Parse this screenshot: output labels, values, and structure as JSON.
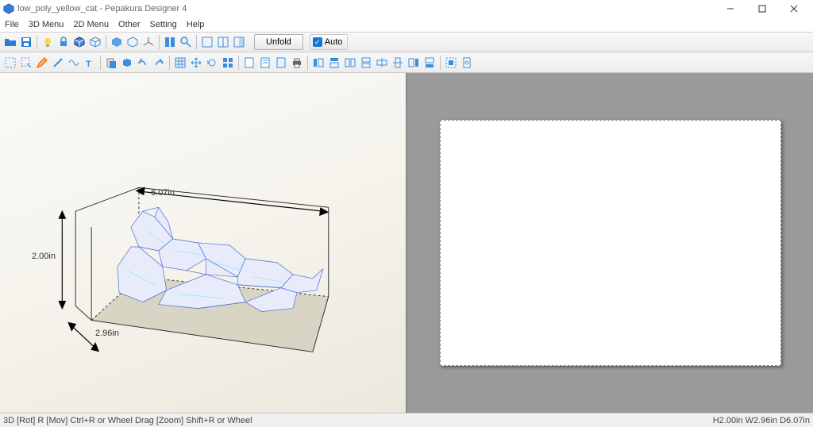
{
  "title": "low_poly_yellow_cat - Pepakura Designer 4",
  "menu": [
    "File",
    "3D Menu",
    "2D Menu",
    "Other",
    "Setting",
    "Help"
  ],
  "toolbar1": {
    "unfold": "Unfold",
    "auto": "Auto"
  },
  "dimensions": {
    "height": "2.00in",
    "depth": "2.96in",
    "width": "6.07in"
  },
  "status_left": "3D [Rot] R [Mov] Ctrl+R or Wheel Drag [Zoom] Shift+R or Wheel",
  "status_right": "H2.00in W2.96in D6.07in"
}
